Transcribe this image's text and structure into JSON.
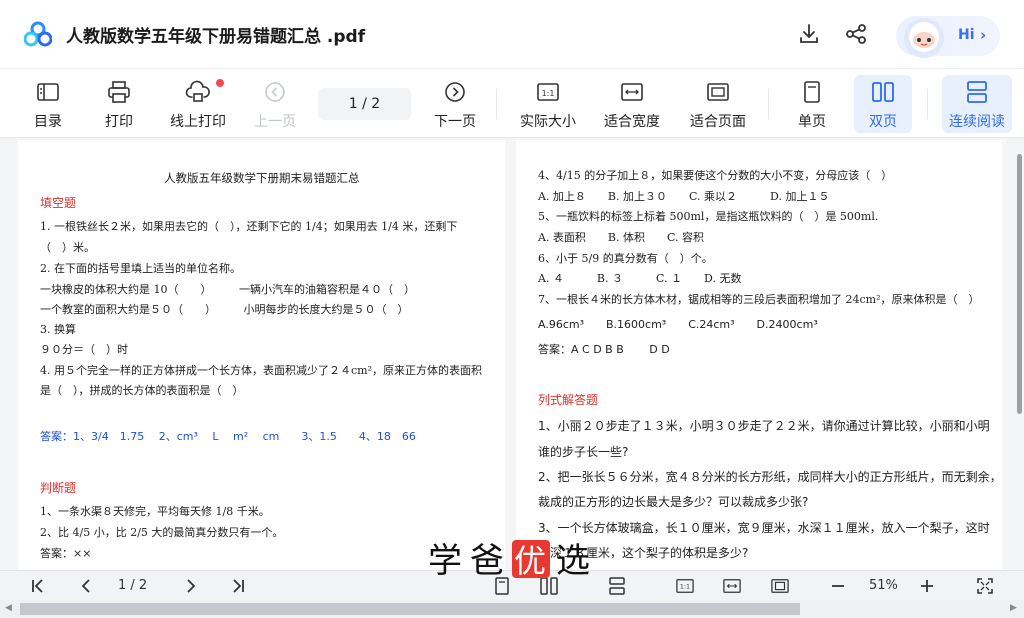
{
  "title_bar": {
    "document_title": "人教版数学五年级下册易错题汇总 .pdf",
    "download_icon": "download-icon",
    "share_icon": "share-icon",
    "assistant_label": "Hi",
    "assistant_chevron": "›"
  },
  "toolbar": {
    "toc": "目录",
    "print": "打印",
    "online_print": "线上打印",
    "prev_page": "上一页",
    "page_indicator": "1 / 2",
    "next_page": "下一页",
    "actual_size": "实际大小",
    "fit_width": "适合宽度",
    "fit_page": "适合页面",
    "single_page": "单页",
    "double_page": "双页",
    "continuous": "连续阅读",
    "accent_color": "#2f6bef",
    "notification_color": "#f04a4a"
  },
  "left_page": {
    "title": "人教版五年级数学下册期末易错题汇总",
    "section_fill": "填空题",
    "q1a": "1. 一根铁丝长２米，如果用去它的（　），还剩下它的 1/4；如果用去 1/4 米，还剩下",
    "q1b": "（　）米。",
    "q2": "2. 在下面的括号里填上适当的单位名称。",
    "q2a": "一块橡皮的体积大约是 10（　　）　　　一辆小汽车的油箱容积是４０（　）",
    "q2b": "一个教室的面积大约是５０（　　）　　　小明每步的长度大约是５０（　）",
    "q3": "3. 换算",
    "q3a": "９０分＝（　）时",
    "q4a": "4. 用５个完全一样的正方体拼成一个长方体，表面积减少了２４cm²，原来正方体的表面积",
    "q4b": "是（　），拼成的长方体的表面积是（　）",
    "answer_fill": "答案：1、3/4　1.75　 2、cm³　 L　 m²　 cm　　3、1.5　　4、18　66",
    "section_judge": "判断题",
    "j1": "1、一条水渠８天修完，平均每天修 1/8 千米。",
    "j2": "2、比 4/5 小，比 2/5 大的最简真分数只有一个。",
    "answer_judge": "答案：××"
  },
  "right_page": {
    "r1": "4、4/15 的分子加上８，如果要使这个分数的大小不变，分母应该（　）",
    "r1o": "A. 加上８　　B. 加上３０　　C. 乘以２　　　D. 加上１５",
    "r2": "5、一瓶饮料的标签上标着 500ml，是指这瓶饮料的（　）是 500ml.",
    "r2o": "A. 表面积　　B. 体积　　C. 容积",
    "r3": "6、小于 5/9 的真分数有（　）个。",
    "r3o": "A. ４　　　B. ３　　　C. １　　D. 无数",
    "r4": "7、一根长４米的长方体木材，锯成相等的三段后表面积增加了 24cm²，原来体积是（　）",
    "r4o": "A.96cm³　　B.1600cm³　　C.24cm³　　D.2400cm³",
    "answer_choice": "答案：A C D B B　　 D D",
    "section_calc": "列式解答题",
    "c1a": "1、小丽２０步走了１３米，小明３０步走了２２米，请你通过计算比较，小丽和小明",
    "c1b": "谁的步子长一些?",
    "c2a": "2、把一张长５６分米，宽４８分米的长方形纸，成同样大小的正方形纸片，而无剩余，",
    "c2b": "裁成的正方形的边长最大是多少？可以裁成多少张?",
    "c3a": "3、一个长方体玻璃盒，长１０厘米，宽９厘米，水深１１厘米，放入一个梨子，这时",
    "c3b": "水深１３厘米，这个梨子的体积是多少?"
  },
  "bottom_bar": {
    "page_indicator": "1 / 2",
    "zoom": "51%"
  },
  "watermark": {
    "text_1": "学",
    "text_2": "爸",
    "text_3": "优",
    "text_4": "选",
    "highlight_color": "#e8382f"
  }
}
